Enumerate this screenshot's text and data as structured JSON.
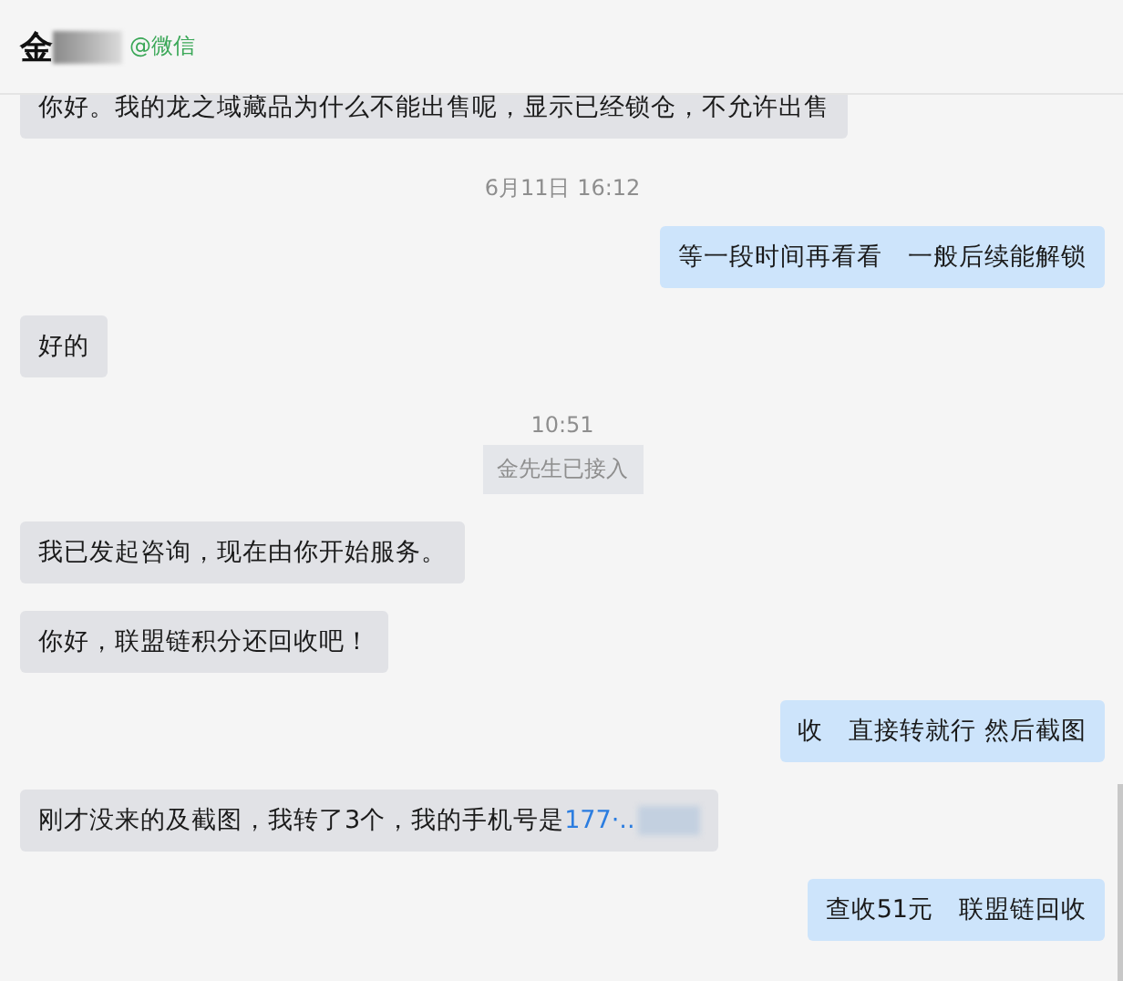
{
  "header": {
    "name": "金",
    "source": "@微信"
  },
  "messages": [
    {
      "kind": "incoming",
      "text": "你好。我的龙之域藏品为什么不能出售呢，显示已经锁仓，不允许出售"
    },
    {
      "kind": "time",
      "text": "6月11日 16:12"
    },
    {
      "kind": "outgoing",
      "text": "等一段时间再看看　一般后续能解锁"
    },
    {
      "kind": "incoming",
      "text": "好的"
    },
    {
      "kind": "time",
      "text": "10:51"
    },
    {
      "kind": "system",
      "text": "金先生已接入"
    },
    {
      "kind": "incoming",
      "text": "我已发起咨询，现在由你开始服务。"
    },
    {
      "kind": "incoming",
      "text": "你好，联盟链积分还回收吧！"
    },
    {
      "kind": "outgoing",
      "text": "收　直接转就行 然后截图"
    },
    {
      "kind": "incoming",
      "text": "刚才没来的及截图，我转了3个，我的手机号是",
      "link": "177·.."
    },
    {
      "kind": "outgoing",
      "text": "查收51元　联盟链回收"
    }
  ]
}
